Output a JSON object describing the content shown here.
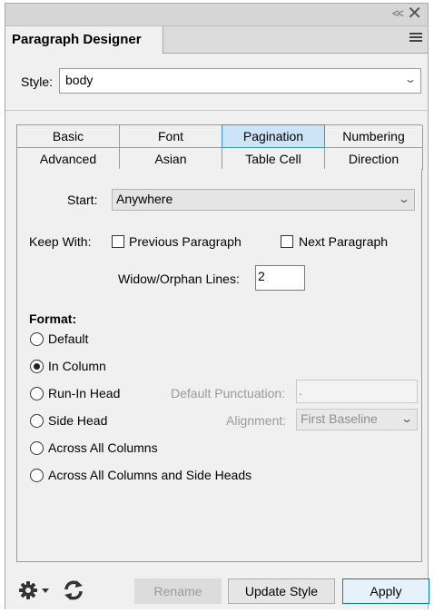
{
  "window": {
    "collapse_glyph": "<<",
    "close_glyph": "✕"
  },
  "panel": {
    "title": "Paragraph Designer"
  },
  "style": {
    "label": "Style:",
    "value": "body"
  },
  "tabs": {
    "row1": [
      "Basic",
      "Font",
      "Pagination",
      "Numbering"
    ],
    "row2": [
      "Advanced",
      "Asian",
      "Table Cell",
      "Direction"
    ],
    "active": "Pagination"
  },
  "pagination": {
    "start_label": "Start:",
    "start_value": "Anywhere",
    "keep_with_label": "Keep With:",
    "previous_paragraph_label": "Previous Paragraph",
    "previous_paragraph_checked": false,
    "next_paragraph_label": "Next Paragraph",
    "next_paragraph_checked": false,
    "widow_orphan_label": "Widow/Orphan Lines:",
    "widow_orphan_value": "2",
    "format_label": "Format:",
    "format_options": [
      "Default",
      "In Column",
      "Run-In Head",
      "Side Head",
      "Across All Columns",
      "Across All Columns and Side Heads"
    ],
    "format_selected": "In Column",
    "default_punctuation_label": "Default Punctuation:",
    "default_punctuation_value": ".",
    "alignment_label": "Alignment:",
    "alignment_value": "First Baseline"
  },
  "buttons": {
    "rename": "Rename",
    "update_style": "Update Style",
    "apply": "Apply"
  },
  "colors": {
    "active_tab_bg": "#cde4f7",
    "active_tab_border": "#3d8ee0",
    "primary_button_border": "#0078d7"
  }
}
